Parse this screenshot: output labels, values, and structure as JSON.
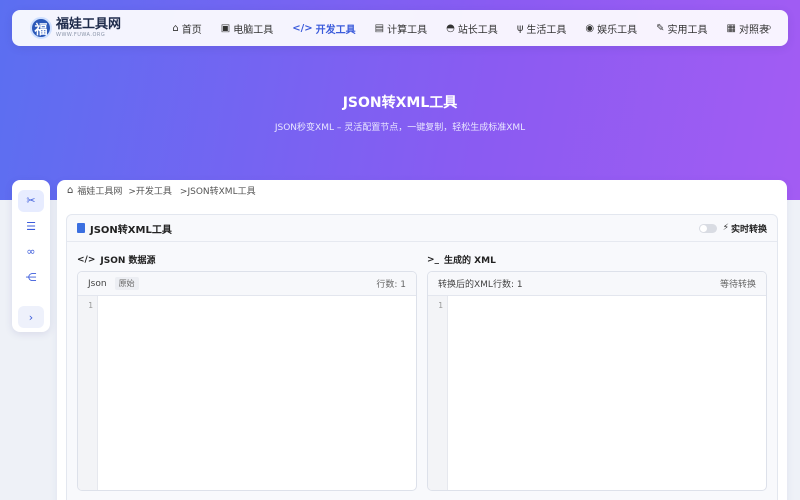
{
  "logo": {
    "name": "福娃工具网",
    "sub": "WWW.FUWA.ORG",
    "badge": "福"
  },
  "nav": [
    {
      "label": "首页",
      "icon": "home-icon",
      "glyph": "⌂"
    },
    {
      "label": "电脑工具",
      "icon": "computer-icon",
      "glyph": "▣"
    },
    {
      "label": "开发工具",
      "icon": "code-icon",
      "glyph": "</>",
      "active": true
    },
    {
      "label": "计算工具",
      "icon": "calculator-icon",
      "glyph": "▤"
    },
    {
      "label": "站长工具",
      "icon": "webmaster-icon",
      "glyph": "◓"
    },
    {
      "label": "生活工具",
      "icon": "utensils-icon",
      "glyph": "ψ"
    },
    {
      "label": "娱乐工具",
      "icon": "gamepad-icon",
      "glyph": "◉"
    },
    {
      "label": "实用工具",
      "icon": "wrench-icon",
      "glyph": "✎"
    },
    {
      "label": "对照表",
      "icon": "table-icon",
      "glyph": "▦"
    }
  ],
  "hero": {
    "title": "JSON转XML工具",
    "subtitle": "JSON秒变XML – 灵活配置节点，一键复制，轻松生成标准XML"
  },
  "breadcrumb": [
    "福娃工具网",
    ">开发工具",
    ">JSON转XML工具"
  ],
  "tool": {
    "title": "JSON转XML工具",
    "realtime_label": "实时转换",
    "input_panel": {
      "label": "JSON 数据源",
      "head_left": "Json",
      "tag": "原始",
      "head_right": "行数: 1",
      "line": "1"
    },
    "output_panel": {
      "label": "生成的 XML",
      "head_left": "转换后的XML行数: 1",
      "head_right": "等待转换",
      "line": "1"
    }
  },
  "colors": {
    "accent": "#3b5bdb",
    "hero_start": "#5b6ff1",
    "hero_end": "#a35cf3"
  }
}
